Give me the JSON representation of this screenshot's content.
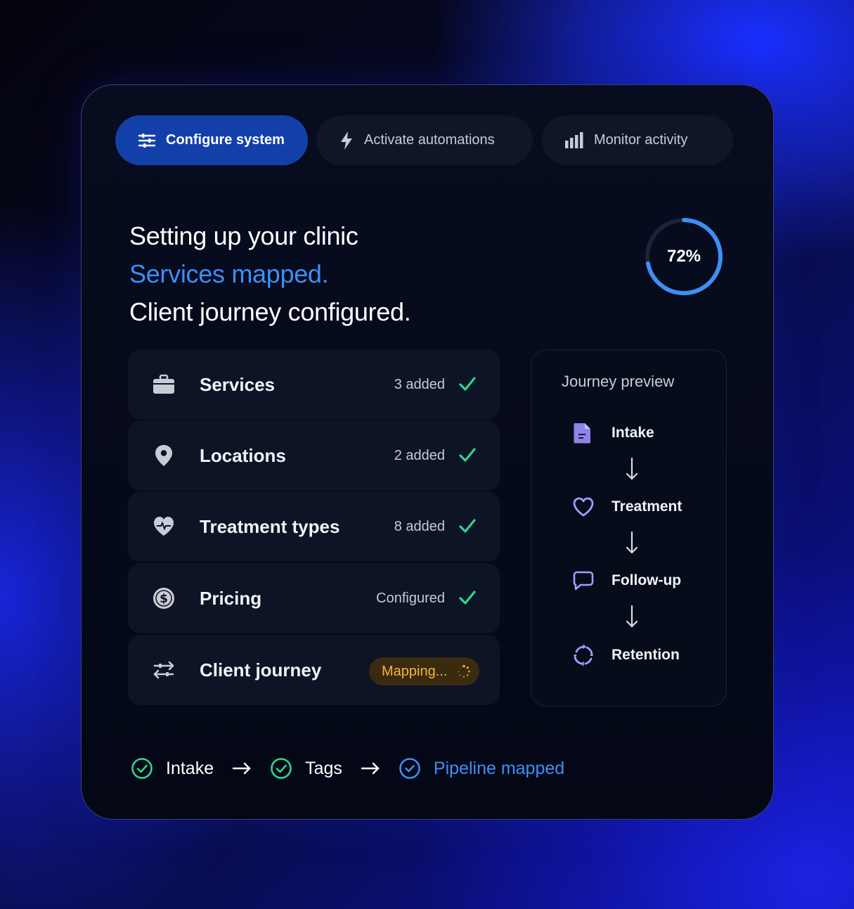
{
  "tabs": [
    {
      "label": "Configure system",
      "icon": "sliders-icon",
      "active": true
    },
    {
      "label": "Activate automations",
      "icon": "lightning-icon",
      "active": false
    },
    {
      "label": "Monitor activity",
      "icon": "bar-chart-icon",
      "active": false
    }
  ],
  "headline": {
    "line1": "Setting up your clinic",
    "line2": "Services mapped.",
    "line3": "Client journey configured."
  },
  "progress": {
    "label": "72%",
    "value": 0.72
  },
  "setup_items": [
    {
      "label": "Services",
      "status": "3 added",
      "icon": "briefcase-icon",
      "done": true
    },
    {
      "label": "Locations",
      "status": "2 added",
      "icon": "map-pin-icon",
      "done": true
    },
    {
      "label": "Treatment types",
      "status": "8 added",
      "icon": "heart-pulse-icon",
      "done": true
    },
    {
      "label": "Pricing",
      "status": "Configured",
      "icon": "dollar-coin-icon",
      "done": true
    },
    {
      "label": "Client journey",
      "status": "Mapping...",
      "icon": "swap-arrows-icon",
      "done": false
    }
  ],
  "journey_preview": {
    "title": "Journey preview",
    "steps": [
      {
        "label": "Intake",
        "icon": "document-icon"
      },
      {
        "label": "Treatment",
        "icon": "heart-icon"
      },
      {
        "label": "Follow-up",
        "icon": "chat-bubble-icon"
      },
      {
        "label": "Retention",
        "icon": "refresh-cycle-icon"
      }
    ]
  },
  "footer_steps": [
    {
      "label": "Intake",
      "state": "done"
    },
    {
      "label": "Tags",
      "state": "done"
    },
    {
      "label": "Pipeline mapped",
      "state": "current"
    }
  ],
  "colors": {
    "accent_blue": "#3e8ef5",
    "active_tab": "#1340a8",
    "success_green": "#2fd58f",
    "warning_orange": "#f5b43a",
    "journey_icon": "#a79bff"
  }
}
